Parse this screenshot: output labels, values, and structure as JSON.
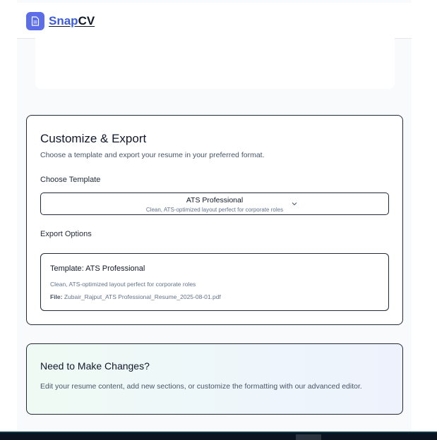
{
  "header": {
    "brand_part1": "Snap",
    "brand_part2": "CV",
    "logo_icon": "document-icon",
    "accent_color": "#5b6ee8"
  },
  "export": {
    "title": "Customize & Export",
    "description": "Choose a template and export your resume in your preferred format.",
    "template_label": "Choose Template",
    "selected_template": {
      "name": "ATS Professional",
      "description": "Clean, ATS-optimized layout perfect for corporate roles"
    },
    "export_label": "Export Options",
    "summary": {
      "title": "Template: ATS Professional",
      "description": "Clean, ATS-optimized layout perfect for corporate roles",
      "file_label": "File:",
      "file_name": "Zubair_Rajput_ATS Professional_Resume_2025-08-01.pdf"
    }
  },
  "changes": {
    "title": "Need to Make Changes?",
    "description": "Edit your resume content, add new sections, or customize the formatting with our advanced editor."
  }
}
